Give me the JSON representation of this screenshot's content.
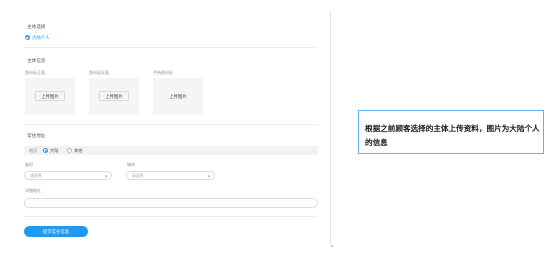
{
  "form": {
    "subject_section": {
      "title": "主体选择",
      "selected_label": "大陆个人"
    },
    "subject_info": {
      "title": "主体信息",
      "uploads": [
        {
          "label": "身份证正面",
          "button": "上传图片"
        },
        {
          "label": "身份证反面",
          "button": "上传图片"
        },
        {
          "label": "手持身份证",
          "button": "上传图片"
        }
      ]
    },
    "address_section": {
      "title": "常住地址",
      "radio_label": "地区",
      "options": [
        {
          "label": "大陆",
          "selected": true
        },
        {
          "label": "其他",
          "selected": false
        }
      ],
      "province_label": "省份",
      "province_placeholder": "请选择",
      "city_label": "城市",
      "city_placeholder": "请选择",
      "detail_label": "详细地址",
      "detail_value": ""
    },
    "submit_label": "提交实名信息"
  },
  "callout": {
    "text": "根据之前顾客选择的主体上传资料，图片为大陆个人的信息"
  },
  "colors": {
    "accent": "#1e9bf0",
    "callout_border": "#59b6f2"
  }
}
